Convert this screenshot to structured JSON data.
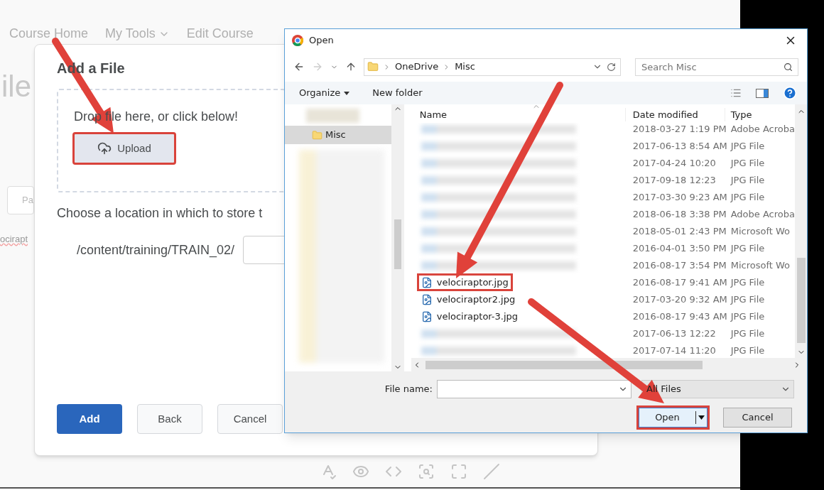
{
  "page": {
    "nav": [
      {
        "label": "Course Home",
        "dropdown": false
      },
      {
        "label": "My Tools",
        "dropdown": true
      },
      {
        "label": "Edit Course",
        "dropdown": false
      }
    ],
    "heading": "ile",
    "field_text": "Pa",
    "link_text": "ocirapt"
  },
  "add_file_modal": {
    "title": "Add a File",
    "drop_hint": "Drop file here, or click below!",
    "upload_button": {
      "label": "Upload",
      "annotated": true
    },
    "location_label": "Choose a location in which to store t",
    "path": "/content/training/TRAIN_02/",
    "buttons": [
      {
        "label": "Add",
        "kind": "primary"
      },
      {
        "label": "Back",
        "kind": "secondary"
      },
      {
        "label": "Cancel",
        "kind": "secondary"
      }
    ]
  },
  "open_dialog": {
    "title": "Open",
    "breadcrumb": [
      "OneDrive",
      "Misc"
    ],
    "search": {
      "placeholder": "Search Misc"
    },
    "toolbar": [
      {
        "label": "Organize",
        "dropdown": true
      },
      {
        "label": "New folder",
        "dropdown": false
      }
    ],
    "nav_pane": [
      {
        "label": "Misc",
        "selected": true
      }
    ],
    "columns": [
      "Name",
      "Date modified",
      "Type"
    ],
    "files": [
      {
        "kind": "blurred",
        "date": "2018-03-27 1:19 PM",
        "type": "Adobe Acroba",
        "annotated": false
      },
      {
        "kind": "blurred",
        "date": "2017-06-13 8:54 AM",
        "type": "JPG File",
        "annotated": false
      },
      {
        "kind": "blurred",
        "date": "2017-04-24 10:20",
        "type": "JPG File",
        "annotated": false
      },
      {
        "kind": "blurred",
        "date": "2017-09-18 12:23",
        "type": "JPG File",
        "annotated": false
      },
      {
        "kind": "blurred",
        "date": "2017-03-30 9:23 AM",
        "type": "JPG File",
        "annotated": false
      },
      {
        "kind": "blurred",
        "date": "2018-06-18 3:38 PM",
        "type": "Adobe Acroba",
        "annotated": false
      },
      {
        "kind": "blurred",
        "date": "2018-05-01 2:43 PM",
        "type": "Microsoft Wo",
        "annotated": false
      },
      {
        "kind": "blurred",
        "date": "2016-04-01 3:50 PM",
        "type": "JPG File",
        "annotated": false
      },
      {
        "kind": "blurred",
        "date": "2016-08-17 3:54 PM",
        "type": "Microsoft Wo",
        "annotated": false
      },
      {
        "kind": "image",
        "name": "velociraptor.jpg",
        "date": "2016-08-17 9:41 AM",
        "type": "JPG File",
        "annotated": true
      },
      {
        "kind": "image",
        "name": "velociraptor2.jpg",
        "date": "2017-03-20 9:32 AM",
        "type": "JPG File",
        "annotated": false
      },
      {
        "kind": "image",
        "name": "velociraptor-3.jpg",
        "date": "2016-08-17 9:43 AM",
        "type": "JPG File",
        "annotated": false
      },
      {
        "kind": "blurred",
        "date": "2017-06-13 12:22",
        "type": "JPG File",
        "annotated": false
      },
      {
        "kind": "blurred",
        "date": "2017-07-14 11:20",
        "type": "JPG File",
        "annotated": false
      }
    ],
    "file_name_label": "File name:",
    "file_type": "All Files",
    "buttons": [
      {
        "label": "Open",
        "kind": "split",
        "annotated": true
      },
      {
        "label": "Cancel",
        "kind": "plain",
        "annotated": false
      }
    ]
  }
}
